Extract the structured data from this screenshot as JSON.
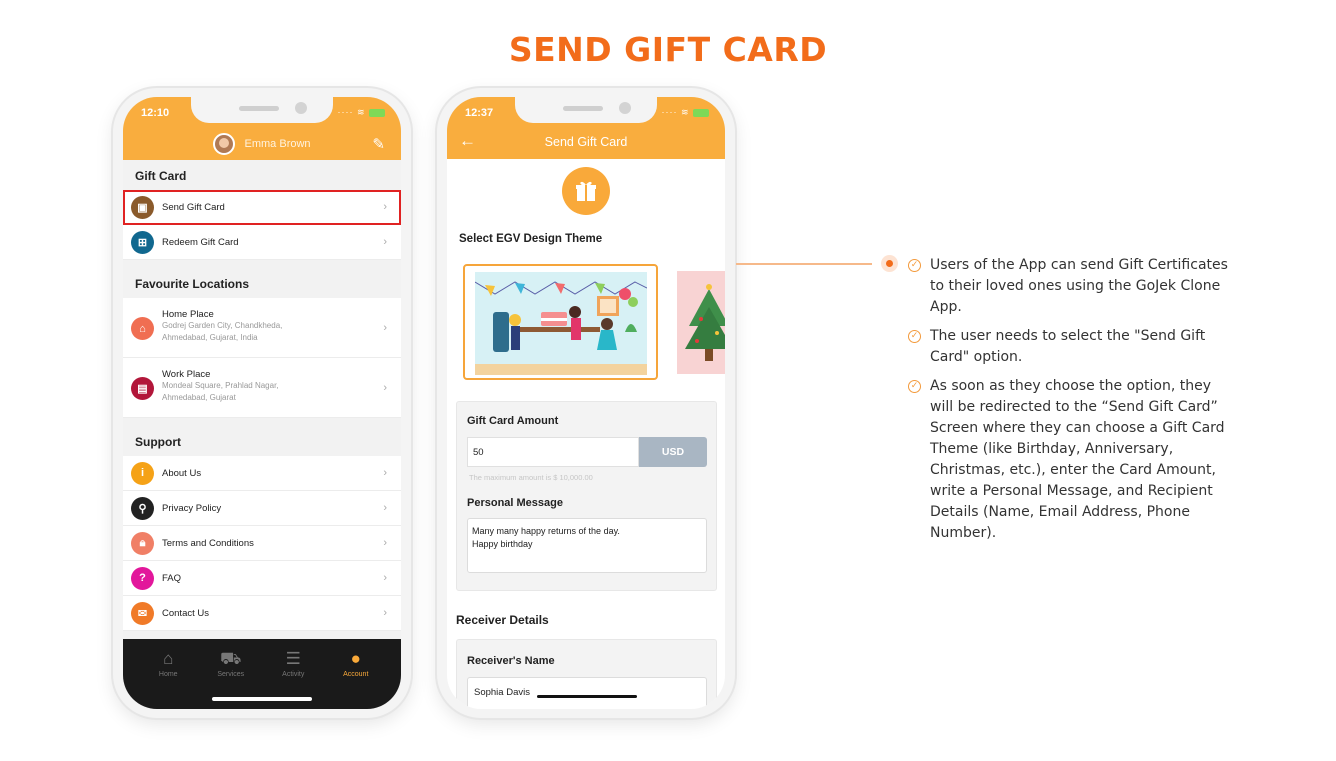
{
  "page": {
    "title": "SEND GIFT CARD",
    "accent": "#f26c1a",
    "header_color": "#f9ad3e"
  },
  "phone1": {
    "status_time": "12:10",
    "user_name": "Emma Brown",
    "sections": {
      "gift_card": "Gift Card",
      "favourite": "Favourite Locations",
      "support": "Support"
    },
    "gift_items": [
      {
        "label": "Send Gift Card",
        "icon": "gift-icon",
        "color": "#8a5a2b"
      },
      {
        "label": "Redeem Gift Card",
        "icon": "basket-icon",
        "color": "#11688f"
      }
    ],
    "places": [
      {
        "label": "Home Place",
        "address": "Godrej Garden City, Chandkheda,\nAhmedabad, Gujarat, India",
        "icon": "home-pin-icon",
        "color": "#f06e52"
      },
      {
        "label": "Work Place",
        "address": "Mondeal Square, Prahlad Nagar,\nAhmedabad, Gujarat",
        "icon": "work-pin-icon",
        "color": "#b2163a"
      }
    ],
    "support_items": [
      {
        "label": "About Us",
        "icon": "info-icon",
        "color": "#f5a217",
        "glyph": "i"
      },
      {
        "label": "Privacy Policy",
        "icon": "privacy-icon",
        "color": "#222222",
        "glyph": "P"
      },
      {
        "label": "Terms and Conditions",
        "icon": "lock-icon",
        "color": "#f07f66",
        "glyph": "T"
      },
      {
        "label": "FAQ",
        "icon": "question-icon",
        "color": "#e2179b",
        "glyph": "?"
      },
      {
        "label": "Contact Us",
        "icon": "mail-icon",
        "color": "#f07a28",
        "glyph": "✉"
      }
    ],
    "tabs": [
      {
        "label": "Home",
        "icon": "home-icon",
        "glyph": "⌂"
      },
      {
        "label": "Services",
        "icon": "car-icon",
        "glyph": "🚗"
      },
      {
        "label": "Activity",
        "icon": "activity-icon",
        "glyph": "☰"
      },
      {
        "label": "Account",
        "icon": "account-icon",
        "glyph": "●"
      }
    ]
  },
  "phone2": {
    "status_time": "12:37",
    "screen_title": "Send Gift Card",
    "select_theme_label": "Select EGV Design Theme",
    "amount_label": "Gift Card Amount",
    "amount_value": "50",
    "currency": "USD",
    "amount_hint": "The maximum amount is $ 10,000.00",
    "message_label": "Personal Message",
    "message_value": "Many many happy returns of the day.\nHappy birthday",
    "receiver_section": "Receiver Details",
    "receiver_name_label": "Receiver's Name",
    "receiver_name_value": "Sophia Davis"
  },
  "callout": {
    "bullets": [
      "Users of the App can send Gift Certificates to their loved ones using the GoJek Clone App.",
      "The user needs to select the \"Send Gift Card\" option.",
      "As soon as they choose the option, they will be redirected to the “Send Gift Card” Screen where they can choose a Gift Card Theme (like Birthday, Anniversary, Christmas, etc.), enter the Card Amount, write a Personal Message, and Recipient Details (Name, Email Address, Phone Number)."
    ]
  }
}
